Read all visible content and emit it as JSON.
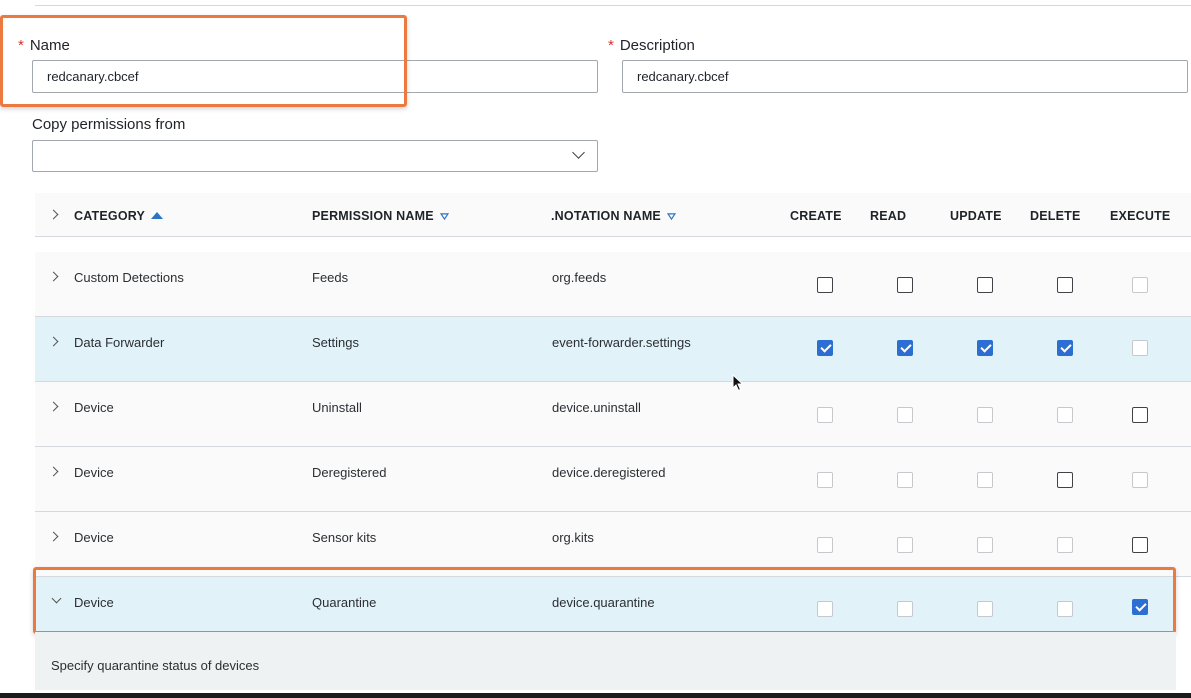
{
  "form": {
    "name_label": "Name",
    "name_value": "redcanary.cbcef",
    "description_label": "Description",
    "description_value": "redcanary.cbcef",
    "required_mark": "*",
    "copy_label": "Copy permissions from",
    "copy_value": ""
  },
  "table": {
    "headers": {
      "category": "CATEGORY",
      "permission_name": "PERMISSION NAME",
      "notation_name": ".NOTATION NAME",
      "create": "CREATE",
      "read": "READ",
      "update": "UPDATE",
      "delete": "DELETE",
      "execute": "EXECUTE"
    },
    "rows": [
      {
        "category": "Custom Detections",
        "permission": "Feeds",
        "notation": "org.feeds"
      },
      {
        "category": "Data Forwarder",
        "permission": "Settings",
        "notation": "event-forwarder.settings"
      },
      {
        "category": "Device",
        "permission": "Uninstall",
        "notation": "device.uninstall"
      },
      {
        "category": "Device",
        "permission": "Deregistered",
        "notation": "device.deregistered"
      },
      {
        "category": "Device",
        "permission": "Sensor kits",
        "notation": "org.kits"
      },
      {
        "category": "Device",
        "permission": "Quarantine",
        "notation": "device.quarantine"
      }
    ],
    "expanded_description": "Specify quarantine status of devices"
  },
  "colors": {
    "accent": "#2a6fd1",
    "highlight": "#ec7a40",
    "selected_row": "#e1f2f9",
    "required": "#d9302c"
  },
  "icons": {
    "sort_ascending": "triangle-up-icon",
    "sort_unsorted": "triangle-down-outline-icon",
    "row_expander": "chevron-right-icon",
    "row_collapser": "chevron-down-icon",
    "select_toggle": "chevron-down-icon"
  }
}
